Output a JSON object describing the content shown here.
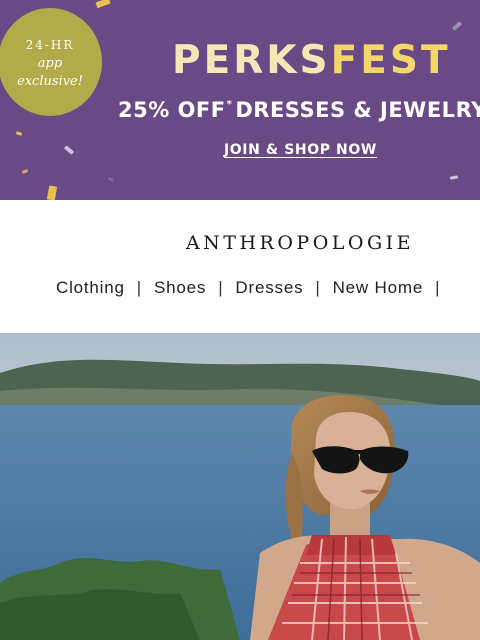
{
  "promo": {
    "badge": {
      "line1": "24-HR",
      "line2": "app",
      "line3": "exclusive!"
    },
    "headline_part1": "PERKS",
    "headline_part2": "FEST",
    "offer_text": "25% OFF",
    "offer_mark": "*",
    "offer_items": "DRESSES & JEWELRY",
    "cta_label": "JOIN & SHOP NOW",
    "colors": {
      "background": "#6a4a86",
      "badge": "#b3aa4a",
      "headline": "#f7e6b6",
      "accent": "#f4d76a"
    }
  },
  "header": {
    "brand": "ANTHROPOLOGIE",
    "nav": [
      {
        "label": "Clothing"
      },
      {
        "label": "Shoes"
      },
      {
        "label": "Dresses"
      },
      {
        "label": "New Home"
      }
    ],
    "separator": "|"
  },
  "hero": {
    "subject": "woman in sunglasses and plaid halter top by the water"
  }
}
